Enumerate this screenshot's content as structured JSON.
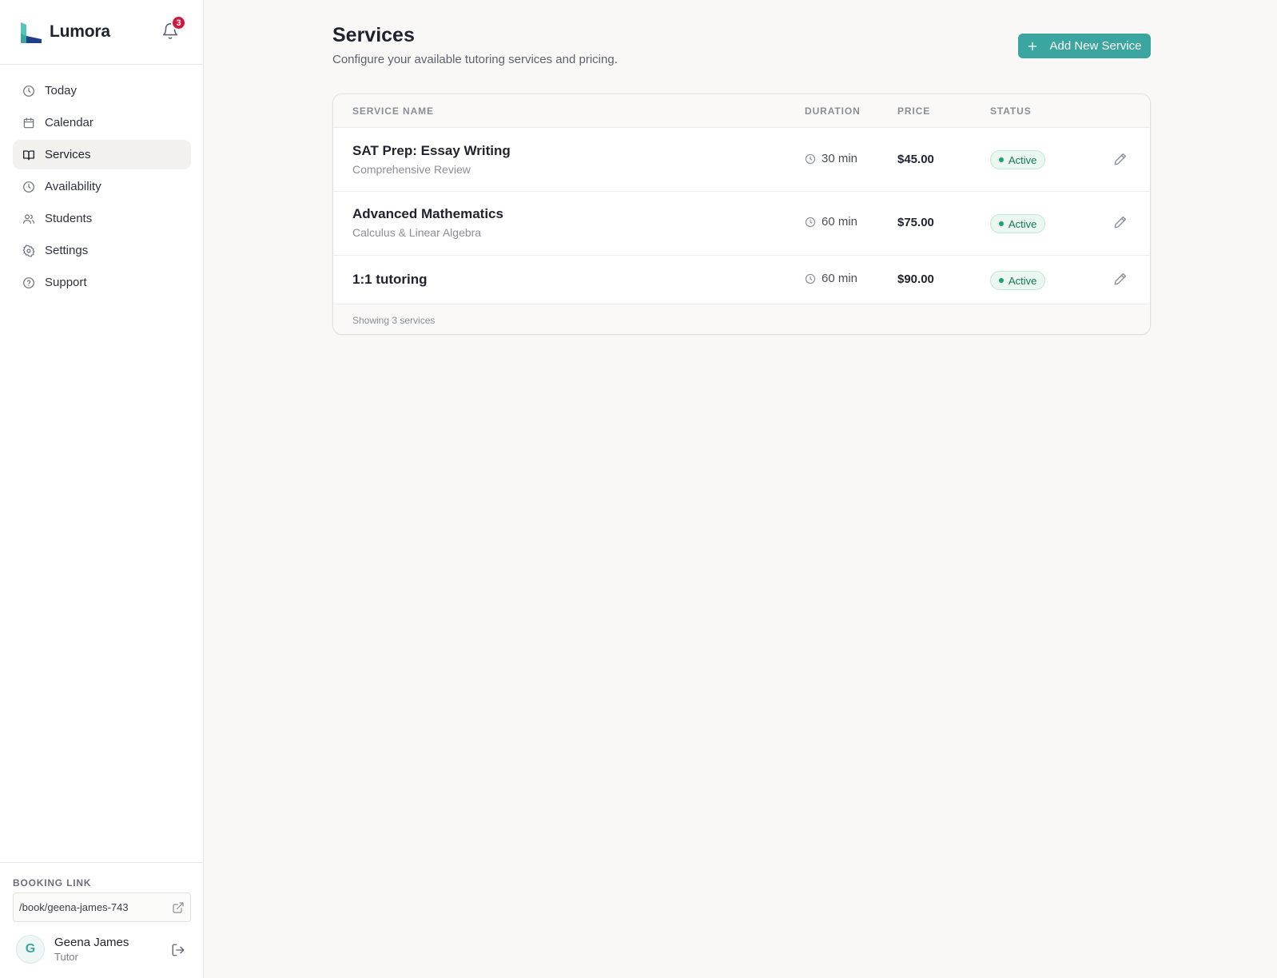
{
  "brand": {
    "name": "Lumora",
    "notification_count": "3"
  },
  "nav": {
    "items": [
      {
        "label": "Today",
        "icon": "clock-icon"
      },
      {
        "label": "Calendar",
        "icon": "calendar-icon"
      },
      {
        "label": "Services",
        "icon": "book-icon",
        "active": true
      },
      {
        "label": "Availability",
        "icon": "clock-icon"
      },
      {
        "label": "Students",
        "icon": "users-icon"
      },
      {
        "label": "Settings",
        "icon": "gear-icon"
      },
      {
        "label": "Support",
        "icon": "help-circle-icon"
      }
    ]
  },
  "booking": {
    "title": "BOOKING LINK",
    "link": "/book/geena-james-743"
  },
  "user": {
    "initial": "G",
    "name": "Geena James",
    "role": "Tutor"
  },
  "page": {
    "title": "Services",
    "subtitle": "Configure your available tutoring services and pricing.",
    "add_button": "Add New Service"
  },
  "table": {
    "headers": {
      "name": "SERVICE NAME",
      "duration": "DURATION",
      "price": "PRICE",
      "status": "STATUS"
    },
    "rows": [
      {
        "name": "SAT Prep: Essay Writing",
        "description": "Comprehensive Review",
        "duration": "30 min",
        "price": "$45.00",
        "status": "Active"
      },
      {
        "name": "Advanced Mathematics",
        "description": "Calculus & Linear Algebra",
        "duration": "60 min",
        "price": "$75.00",
        "status": "Active"
      },
      {
        "name": "1:1 tutoring",
        "description": "",
        "duration": "60 min",
        "price": "$90.00",
        "status": "Active"
      }
    ],
    "footer": "Showing 3 services"
  },
  "colors": {
    "accent": "#3aa69f",
    "badge_red": "#d1173b",
    "status_green": "#16a46a"
  }
}
